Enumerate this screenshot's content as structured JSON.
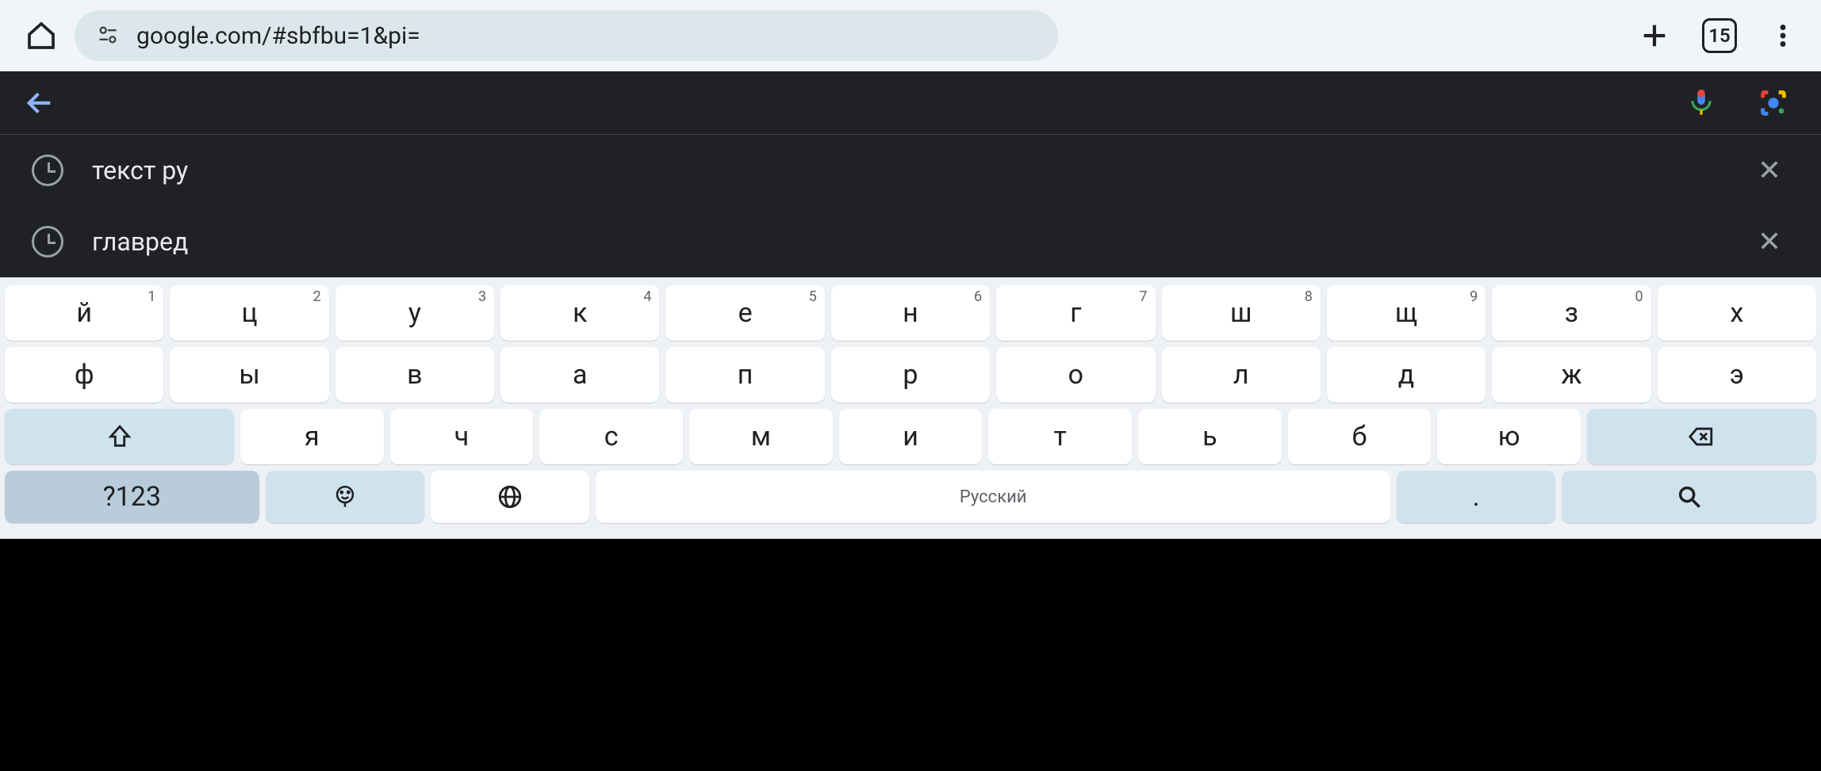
{
  "browser": {
    "url": "google.com/#sbfbu=1&pi=",
    "tab_count": "15"
  },
  "search": {
    "suggestions": [
      {
        "text": "текст ру"
      },
      {
        "text": "главред"
      }
    ]
  },
  "keyboard": {
    "row1": [
      {
        "main": "й",
        "sup": "1"
      },
      {
        "main": "ц",
        "sup": "2"
      },
      {
        "main": "у",
        "sup": "3"
      },
      {
        "main": "к",
        "sup": "4"
      },
      {
        "main": "е",
        "sup": "5"
      },
      {
        "main": "н",
        "sup": "6"
      },
      {
        "main": "г",
        "sup": "7"
      },
      {
        "main": "ш",
        "sup": "8"
      },
      {
        "main": "щ",
        "sup": "9"
      },
      {
        "main": "з",
        "sup": "0"
      },
      {
        "main": "х",
        "sup": ""
      }
    ],
    "row2": [
      "ф",
      "ы",
      "в",
      "а",
      "п",
      "р",
      "о",
      "л",
      "д",
      "ж",
      "э"
    ],
    "row3": [
      "я",
      "ч",
      "с",
      "м",
      "и",
      "т",
      "ь",
      "б",
      "ю"
    ],
    "symbols_label": "?123",
    "language": "Русский",
    "period": "."
  }
}
